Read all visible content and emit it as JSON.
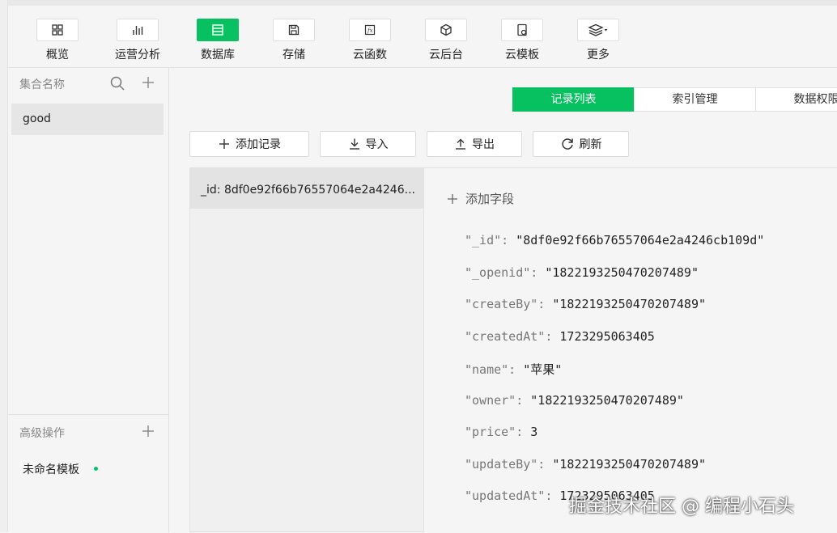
{
  "toolbar": {
    "items": [
      {
        "label": "概览"
      },
      {
        "label": "运营分析"
      },
      {
        "label": "数据库"
      },
      {
        "label": "存储"
      },
      {
        "label": "云函数"
      },
      {
        "label": "云后台"
      },
      {
        "label": "云模板"
      },
      {
        "label": "更多"
      }
    ],
    "active_index": 2,
    "accent_color": "#07c160"
  },
  "sidebar": {
    "collection_header": "集合名称",
    "collections": [
      {
        "name": "good"
      }
    ],
    "advanced_header": "高级操作",
    "template_name": "未命名模板"
  },
  "tabs": [
    {
      "label": "记录列表"
    },
    {
      "label": "索引管理"
    },
    {
      "label": "数据权限"
    }
  ],
  "actions": {
    "add_record": "添加记录",
    "import": "导入",
    "export": "导出",
    "refresh": "刷新"
  },
  "records": [
    {
      "label": "_id: 8df0e92f66b76557064e2a4246..."
    }
  ],
  "detail": {
    "add_field": "添加字段",
    "fields": [
      {
        "key": "\"_id\": ",
        "value": "\"8df0e92f66b76557064e2a4246cb109d\""
      },
      {
        "key": "\"_openid\": ",
        "value": "\"1822193250470207489\""
      },
      {
        "key": "\"createBy\": ",
        "value": "\"1822193250470207489\""
      },
      {
        "key": "\"createdAt\": ",
        "value": "1723295063405"
      },
      {
        "key": "\"name\": ",
        "value": "\"苹果\""
      },
      {
        "key": "\"owner\": ",
        "value": "\"1822193250470207489\""
      },
      {
        "key": "\"price\": ",
        "value": "3"
      },
      {
        "key": "\"updateBy\": ",
        "value": "\"1822193250470207489\""
      },
      {
        "key": "\"updatedAt\": ",
        "value": "1723295063405"
      }
    ]
  },
  "watermark": "掘金技术社区 @ 编程小石头"
}
